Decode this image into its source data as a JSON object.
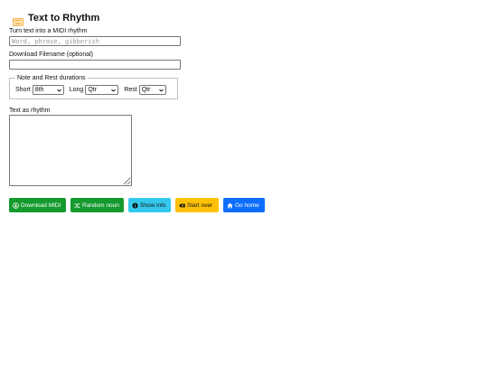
{
  "header": {
    "title": "Text to Rhythm",
    "icon": "keyboard-icon"
  },
  "input": {
    "label": "Turn text into a MIDI rhythm",
    "placeholder": "Word, phrase, gibberish",
    "value": ""
  },
  "filename": {
    "label": "Download Filename (optional)",
    "value": ""
  },
  "durations": {
    "legend": "Note and Rest durations",
    "short_label": "Short",
    "short_value": "8th",
    "long_label": "Long",
    "long_value": "Qtr",
    "rest_label": "Rest",
    "rest_value": "Qtr"
  },
  "output": {
    "label": "Text as rhythm",
    "value": ""
  },
  "buttons": {
    "download": "Download MIDI",
    "random": "Random noun",
    "info": "Show info",
    "start_over": "Start over",
    "home": "Go home"
  },
  "colors": {
    "success": "#159a2e",
    "info": "#34c9ec",
    "warning": "#ffc107",
    "primary": "#0d6efd",
    "keyboard_icon": "#f0a020"
  }
}
